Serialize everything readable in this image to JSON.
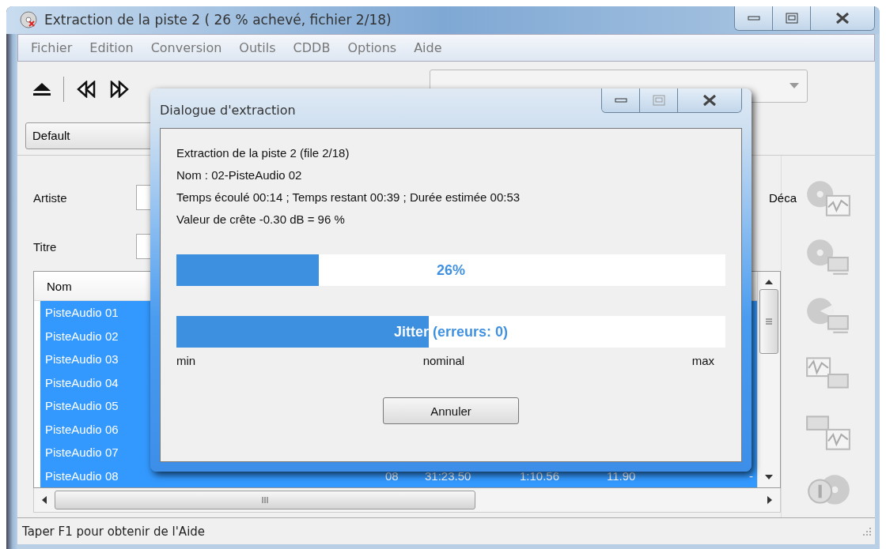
{
  "window": {
    "title": "Extraction de la piste 2 ( 26 % achevé, fichier 2/18)"
  },
  "menu": [
    "Fichier",
    "Edition",
    "Conversion",
    "Outils",
    "CDDB",
    "Options",
    "Aide"
  ],
  "preset": {
    "value": "Default"
  },
  "fields": [
    {
      "label": "Artiste"
    },
    {
      "label": "Titre"
    }
  ],
  "side_label": "Déca",
  "table": {
    "columns": [
      "Nom"
    ],
    "rows": [
      {
        "cells": [
          "PisteAudio 01"
        ],
        "selected": true
      },
      {
        "cells": [
          "PisteAudio 02"
        ],
        "selected": true
      },
      {
        "cells": [
          "PisteAudio 03"
        ],
        "selected": true
      },
      {
        "cells": [
          "PisteAudio 04"
        ],
        "selected": true
      },
      {
        "cells": [
          "PisteAudio 05"
        ],
        "selected": true
      },
      {
        "cells": [
          "PisteAudio 06"
        ],
        "selected": true
      },
      {
        "cells": [
          "PisteAudio 07"
        ],
        "selected": true
      },
      {
        "cells": [
          "PisteAudio 08",
          "08",
          "31:23.50",
          "1:10.56",
          "11.90",
          "-"
        ],
        "selected": true
      }
    ]
  },
  "status_bar": "Taper F1 pour obtenir de l'Aide",
  "dialog": {
    "title": "Dialogue d'extraction",
    "lines": [
      "Extraction de la piste 2 (file 2/18)",
      "Nom : 02-PisteAudio 02",
      "Temps écoulé 00:14 ; Temps restant 00:39 ; Durée estimée 00:53",
      "Valeur de crête -0.30 dB =  96 %"
    ],
    "progress": {
      "label": "26%",
      "level": 0.26
    },
    "jitter": {
      "label": "Jitter (erreurs: 0)",
      "level": 0.46
    },
    "scale": [
      "min",
      "nominal",
      "max"
    ],
    "buttons": [
      "Annuler"
    ]
  }
}
